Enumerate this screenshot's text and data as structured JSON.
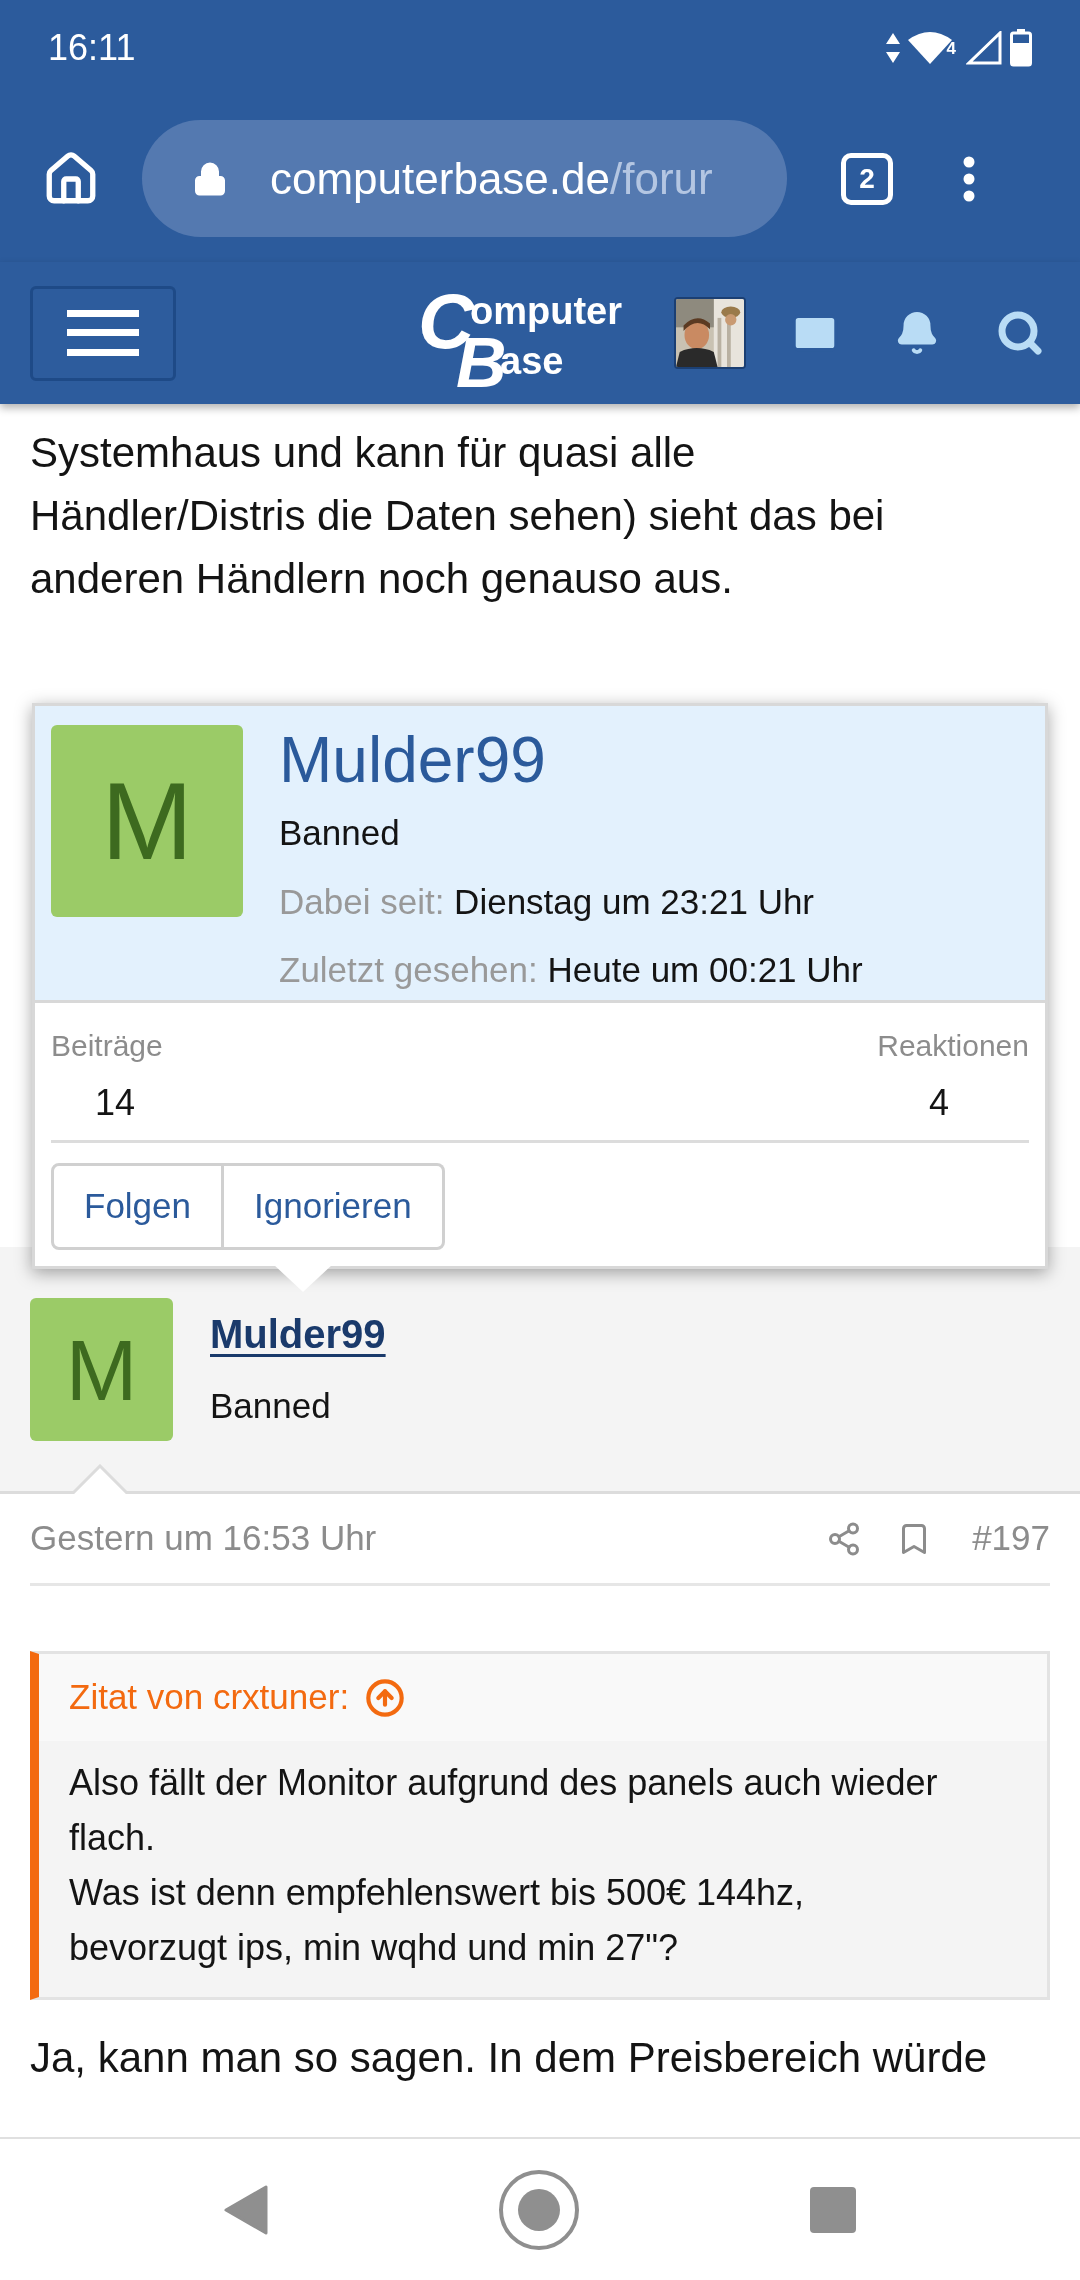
{
  "status_bar": {
    "time": "16:11",
    "wifi_badge": "4"
  },
  "browser": {
    "url_host": "computerbase.de",
    "url_path": "/forur",
    "tab_count": "2"
  },
  "site_header": {
    "logo": {
      "initial_1": "C",
      "rest_1": "omputer",
      "initial_2": "B",
      "rest_2": "ase"
    }
  },
  "post_text": {
    "lines": [
      "Systemhaus und kann für quasi alle",
      "Händler/Distris die Daten sehen) sieht das bei",
      "anderen Händlern noch genauso aus."
    ]
  },
  "member_popup": {
    "avatar_letter": "M",
    "name": "Mulder99",
    "title": "Banned",
    "fields": [
      {
        "label": "Dabei seit:",
        "value": "Dienstag um 23:21 Uhr"
      },
      {
        "label": "Zuletzt gesehen:",
        "value": "Heute um 00:21 Uhr"
      }
    ],
    "stats": [
      {
        "label": "Beiträge",
        "value": "14"
      },
      {
        "label": "Reaktionen",
        "value": "4"
      }
    ],
    "buttons": [
      "Folgen",
      "Ignorieren"
    ]
  },
  "post": {
    "author": {
      "avatar_letter": "M",
      "name": "Mulder99",
      "title": "Banned"
    },
    "date": "Gestern um 16:53 Uhr",
    "number": "#197",
    "quote": {
      "title": "Zitat von crxtuner:",
      "lines": [
        "Also fällt der Monitor aufgrund des panels auch wieder",
        "flach.",
        "Was ist denn empfehlenswert bis 500€ 144hz,",
        "bevorzugt ips, min wqhd und min 27\"?"
      ]
    },
    "reply_lines": [
      "Ja, kann man so sagen. In dem Preisbereich würde"
    ]
  }
}
